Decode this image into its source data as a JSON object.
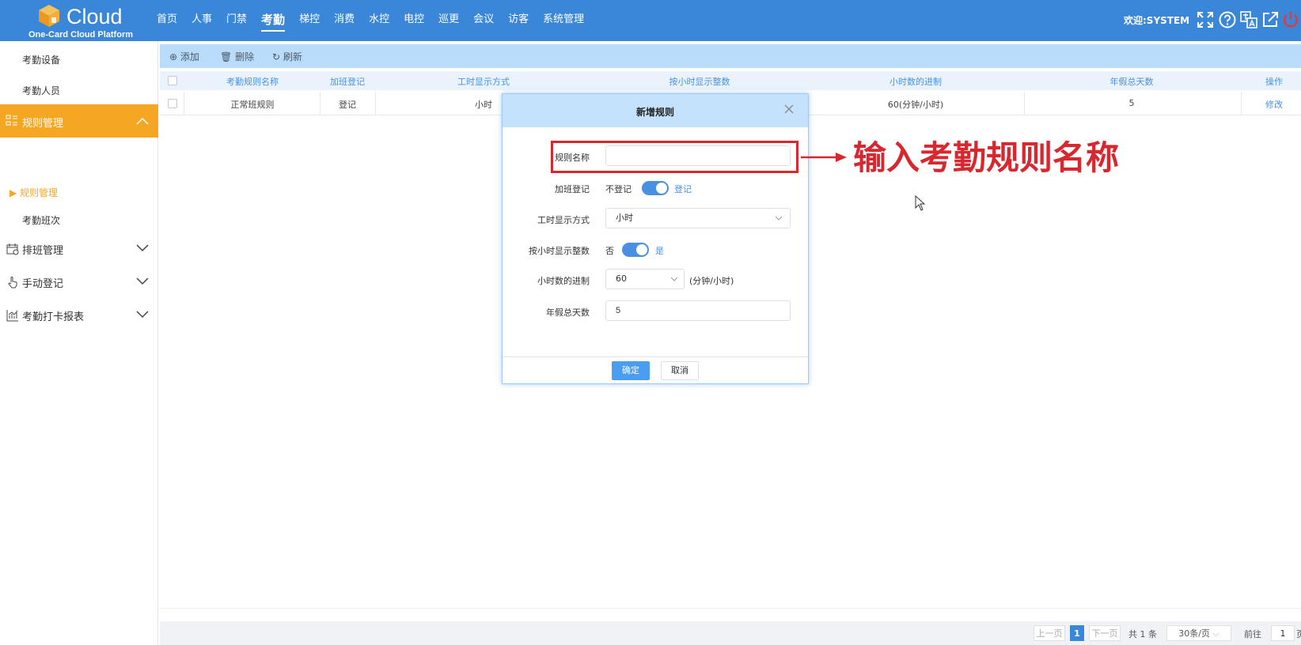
{
  "header": {
    "logo_word": "Cloud",
    "logo_sub": "One-Card Cloud Platform",
    "nav": [
      "首页",
      "人事",
      "门禁",
      "考勤",
      "梯控",
      "消费",
      "水控",
      "电控",
      "巡更",
      "会议",
      "访客",
      "系统管理"
    ],
    "active_nav": "考勤",
    "welcome": "欢迎:SYSTEM",
    "icons": [
      "fullscreen-icon",
      "help-icon",
      "translate-icon",
      "external-link-icon",
      "power-icon"
    ]
  },
  "sidebar": {
    "sub_top": [
      "考勤设备",
      "考勤人员"
    ],
    "active_group": "规则管理",
    "active_children": [
      "规则管理",
      "考勤班次"
    ],
    "groups": [
      "排班管理",
      "手动登记",
      "考勤打卡报表"
    ]
  },
  "toolbar": {
    "add": "添加",
    "delete": "删除",
    "refresh": "刷新"
  },
  "table": {
    "columns": [
      "考勤规则名称",
      "加班登记",
      "工时显示方式",
      "按小时显示整数",
      "小时数的进制",
      "年假总天数",
      "操作"
    ],
    "rows": [
      {
        "name": "正常班规则",
        "overtime": "登记",
        "hour_display": "小时",
        "hour_base": "60(分钟/小时)",
        "annual_days": "5",
        "action": "修改"
      }
    ]
  },
  "pagination": {
    "prev": "上一页",
    "current": "1",
    "next": "下一页",
    "total": "共 1 条",
    "per_page": "30条/页",
    "goto_label": "前往",
    "goto_value": "1",
    "goto_suffix": "页"
  },
  "dialog": {
    "title": "新增规则",
    "fields": {
      "rule_name_label": "规则名称",
      "rule_name_value": "",
      "overtime_label": "加班登记",
      "overtime_off": "不登记",
      "overtime_on": "登记",
      "hour_mode_label": "工时显示方式",
      "hour_mode_value": "小时",
      "integer_label": "按小时显示整数",
      "integer_off": "否",
      "integer_on": "是",
      "base_label": "小时数的进制",
      "base_value": "60",
      "base_unit": "(分钟/小时)",
      "annual_label": "年假总天数",
      "annual_value": "5"
    },
    "ok": "确定",
    "cancel": "取消"
  },
  "annotation": {
    "text": "输入考勤规则名称"
  },
  "colors": {
    "header": "#3a86d8",
    "sidebar_active": "#f5a623",
    "toolbar": "#b9dcfb",
    "primary": "#4a90e2",
    "annotation": "#d8282f"
  }
}
